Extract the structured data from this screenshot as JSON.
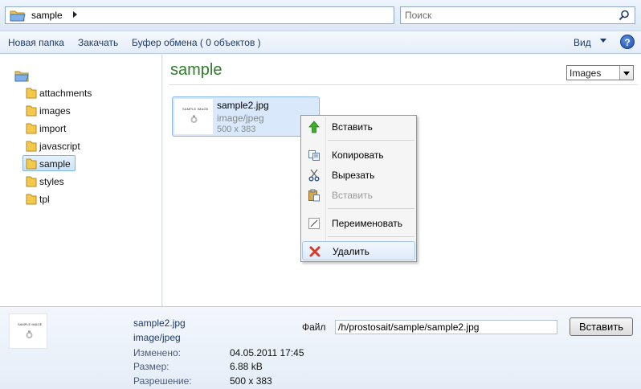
{
  "address_bar": {
    "path": "sample"
  },
  "search": {
    "placeholder": "Поиск"
  },
  "toolbar": {
    "new_folder": "Новая папка",
    "upload": "Закачать",
    "clipboard": "Буфер обмена ( 0 объектов )",
    "view": "Вид",
    "help": "?"
  },
  "sidebar": {
    "items": [
      {
        "label": "attachments"
      },
      {
        "label": "images"
      },
      {
        "label": "import"
      },
      {
        "label": "javascript"
      },
      {
        "label": "sample",
        "selected": true
      },
      {
        "label": "styles"
      },
      {
        "label": "tpl"
      }
    ]
  },
  "main": {
    "folder_title": "sample",
    "filter_select": {
      "value": "Images"
    },
    "files": [
      {
        "name": "sample2.jpg",
        "type": "image/jpeg",
        "dimensions": "500 x 383",
        "thumb_text": "SAMPLE IMAGE"
      }
    ]
  },
  "context_menu": {
    "items": [
      {
        "label": "Вставить",
        "icon": "arrow-up-icon",
        "enabled": true
      },
      {
        "label": "Копировать",
        "icon": "copy-icon",
        "enabled": true
      },
      {
        "label": "Вырезать",
        "icon": "scissors-icon",
        "enabled": true
      },
      {
        "label": "Вставить",
        "icon": "paste-icon",
        "enabled": false
      },
      {
        "label": "Переименовать",
        "icon": "rename-icon",
        "enabled": true
      },
      {
        "label": "Удалить",
        "icon": "delete-icon",
        "enabled": true,
        "hovered": true
      }
    ]
  },
  "details": {
    "name": "sample2.jpg",
    "type": "image/jpeg",
    "modified_label": "Изменено:",
    "modified_value": "04.05.2011 17:45",
    "size_label": "Размер:",
    "size_value": "6.88 kB",
    "resolution_label": "Разрешение:",
    "resolution_value": "500 x 383",
    "file_label": "Файл",
    "file_path": "/h/prostosait/sample/sample2.jpg",
    "insert_button": "Вставить"
  },
  "colors": {
    "folder_title": "#2f7c2b",
    "link": "#1e3a6b",
    "selection": "#d9e9fb"
  }
}
